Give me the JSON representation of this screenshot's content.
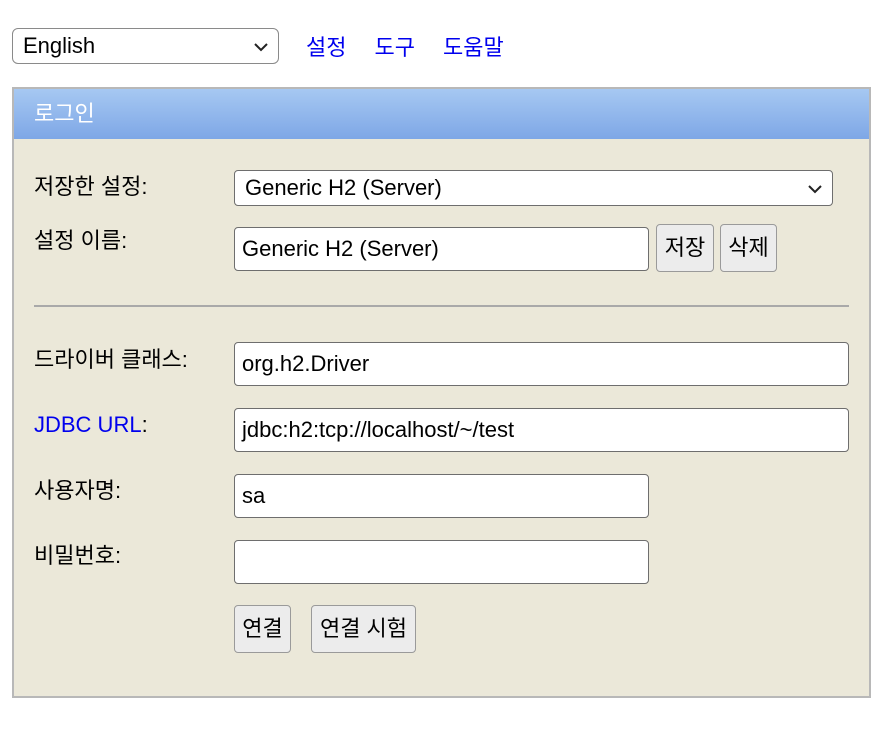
{
  "topbar": {
    "language_value": "English",
    "links": [
      "설정",
      "도구",
      "도움말"
    ]
  },
  "login": {
    "title": "로그인",
    "saved_settings_label": "저장한 설정:",
    "saved_settings_value": "Generic H2 (Server)",
    "setting_name_label": "설정 이름:",
    "setting_name_value": "Generic H2 (Server)",
    "save_button": "저장",
    "delete_button": "삭제",
    "driver_class_label": "드라이버 클래스:",
    "driver_class_value": "org.h2.Driver",
    "jdbc_url_link": "JDBC URL",
    "jdbc_url_colon": ":",
    "jdbc_url_value": "jdbc:h2:tcp://localhost/~/test",
    "username_label": "사용자명:",
    "username_value": "sa",
    "password_label": "비밀번호:",
    "password_value": "",
    "connect_button": "연결",
    "test_connection_button": "연결 시험"
  },
  "colors": {
    "link": "#0000ee",
    "header_gradient_top": "#a6c8f2",
    "header_gradient_bottom": "#7ea7e6",
    "panel_background": "#ebe8d9"
  },
  "icons": {
    "dropdown": "chevron-down-icon"
  }
}
